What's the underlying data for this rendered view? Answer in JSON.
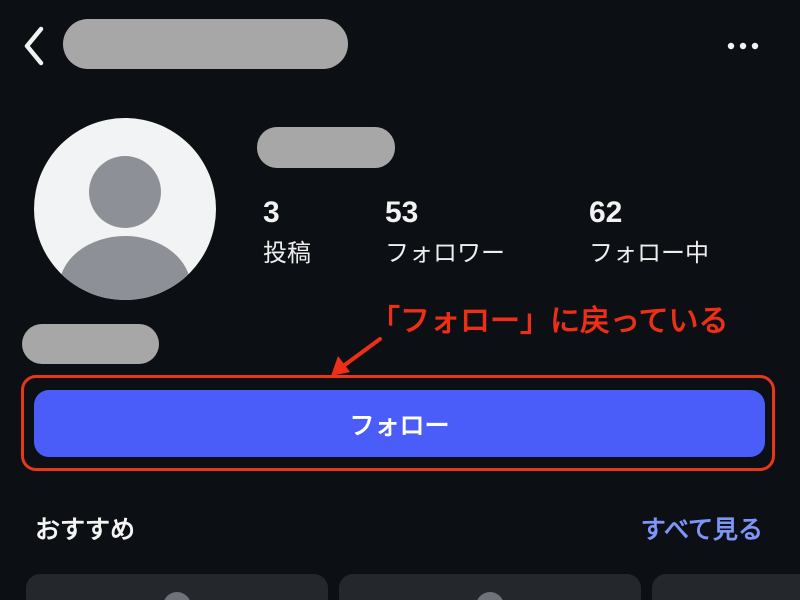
{
  "header": {
    "back_icon": "chevron-left-icon",
    "more_icon": "more-horizontal-icon"
  },
  "profile": {
    "avatar_icon": "default-person-icon",
    "stats": {
      "posts_count": "3",
      "posts_label": "投稿",
      "followers_count": "53",
      "followers_label": "フォロワー",
      "following_count": "62",
      "following_label": "フォロー中"
    },
    "follow_button_label": "フォロー"
  },
  "annotation": {
    "text": "「フォロー」に戻っている",
    "color": "#ee2f16"
  },
  "recommendations": {
    "heading": "おすすめ",
    "see_all_label": "すべて見る"
  },
  "colors": {
    "background": "#0c1014",
    "follow_button": "#4a5df9",
    "link": "#7f94f7",
    "annotation_red": "#e8361d",
    "redaction": "#a7a7a7"
  }
}
